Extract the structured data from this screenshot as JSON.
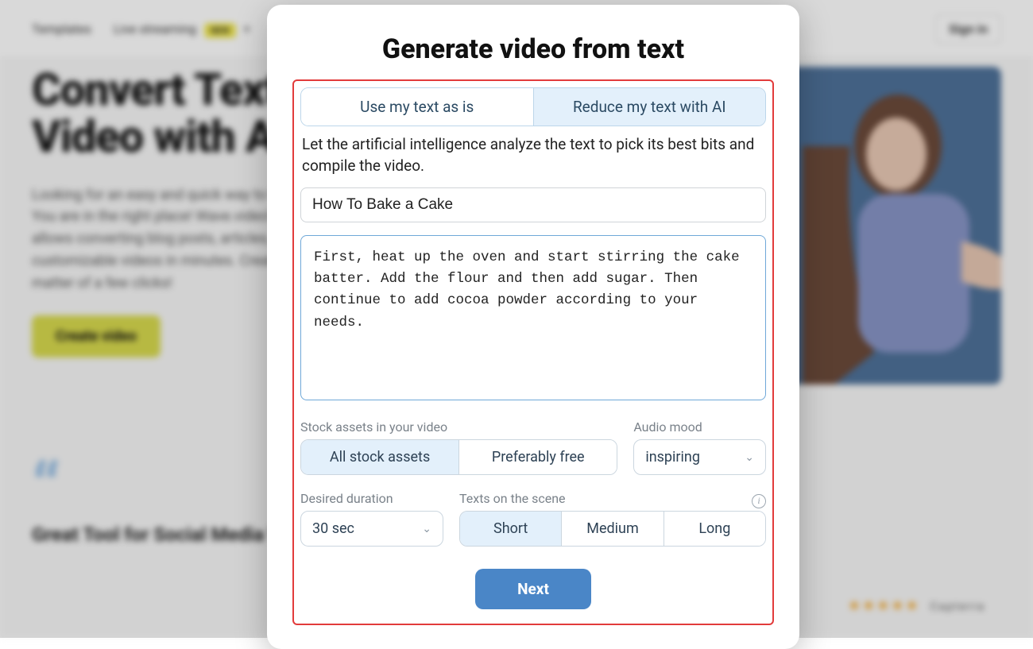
{
  "background": {
    "nav": {
      "item1": "Templates",
      "item2": "Live streaming",
      "badge": "NEW",
      "signin": "Sign in"
    },
    "hero": {
      "title_line1": "Convert Text to",
      "title_line2": "Video with AI",
      "paragraph": "Looking for an easy and quick way to turn text into video online? You are in the right place! Wave.video's AI-powered assistant allows converting blog posts, articles, and text files into engaging customizable videos in minutes. Create videos from text in a matter of a few clicks!",
      "cta": "Create video"
    },
    "testimonial": {
      "title": "Great Tool for Social Media Videos",
      "capterra": "Capterra"
    }
  },
  "modal": {
    "title": "Generate video from text",
    "mode_seg": {
      "option_a": "Use my text as is",
      "option_b": "Reduce my text with AI"
    },
    "description": "Let the artificial intelligence analyze the text to pick its best bits and compile the video.",
    "title_input_value": "How To Bake a Cake",
    "body_text": "First, heat up the oven and start stirring the cake batter. Add the flour and then add sugar. Then continue to add cocoa powder according to your needs.",
    "stock": {
      "label": "Stock assets in your video",
      "option_a": "All stock assets",
      "option_b": "Preferably free"
    },
    "audio": {
      "label": "Audio mood",
      "value": "inspiring"
    },
    "duration": {
      "label": "Desired duration",
      "value": "30 sec"
    },
    "texts_scene": {
      "label": "Texts on the scene",
      "option_a": "Short",
      "option_b": "Medium",
      "option_c": "Long"
    },
    "next": "Next"
  }
}
